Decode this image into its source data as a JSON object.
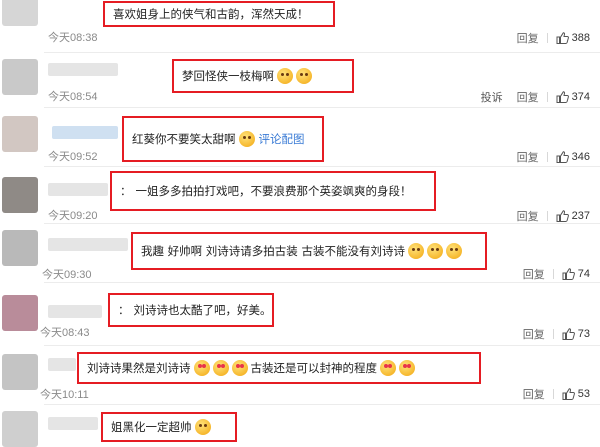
{
  "comments": [
    {
      "text": "喜欢姐身上的侠气和古韵，浑然天成！",
      "time": "今天08:38",
      "reply": "回复",
      "likes": "388",
      "report": null,
      "emoji": 0
    },
    {
      "text": "梦回怪侠一枝梅啊",
      "time": "今天08:54",
      "reply": "回复",
      "likes": "374",
      "report": "投诉",
      "emoji": 2
    },
    {
      "text": "红葵你不要笑太甜啊",
      "time": "今天09:52",
      "reply": "回复",
      "likes": "346",
      "report": null,
      "emoji": 1,
      "link": "评论配图"
    },
    {
      "text": "一姐多多拍拍打戏吧，不要浪费那个英姿飒爽的身段！",
      "time": "今天09:20",
      "reply": "回复",
      "likes": "237",
      "report": null,
      "emoji": 0
    },
    {
      "text": "我趣 好帅啊 刘诗诗请多拍古装 古装不能没有刘诗诗",
      "time": "今天09:30",
      "reply": "回复",
      "likes": "74",
      "report": null,
      "emoji": 3
    },
    {
      "text": "刘诗诗也太酷了吧，好美。",
      "time": "今天08:43",
      "reply": "回复",
      "likes": "73",
      "report": null,
      "emoji": 0
    },
    {
      "text": "刘诗诗果然是刘诗诗",
      "text2": "古装还是可以封神的程度",
      "time": "今天10:11",
      "reply": "回复",
      "likes": "53",
      "report": null,
      "emoji": 3
    },
    {
      "text": "姐黑化一定超帅",
      "time": "",
      "reply": "",
      "likes": "",
      "report": null,
      "emoji": 1
    }
  ]
}
